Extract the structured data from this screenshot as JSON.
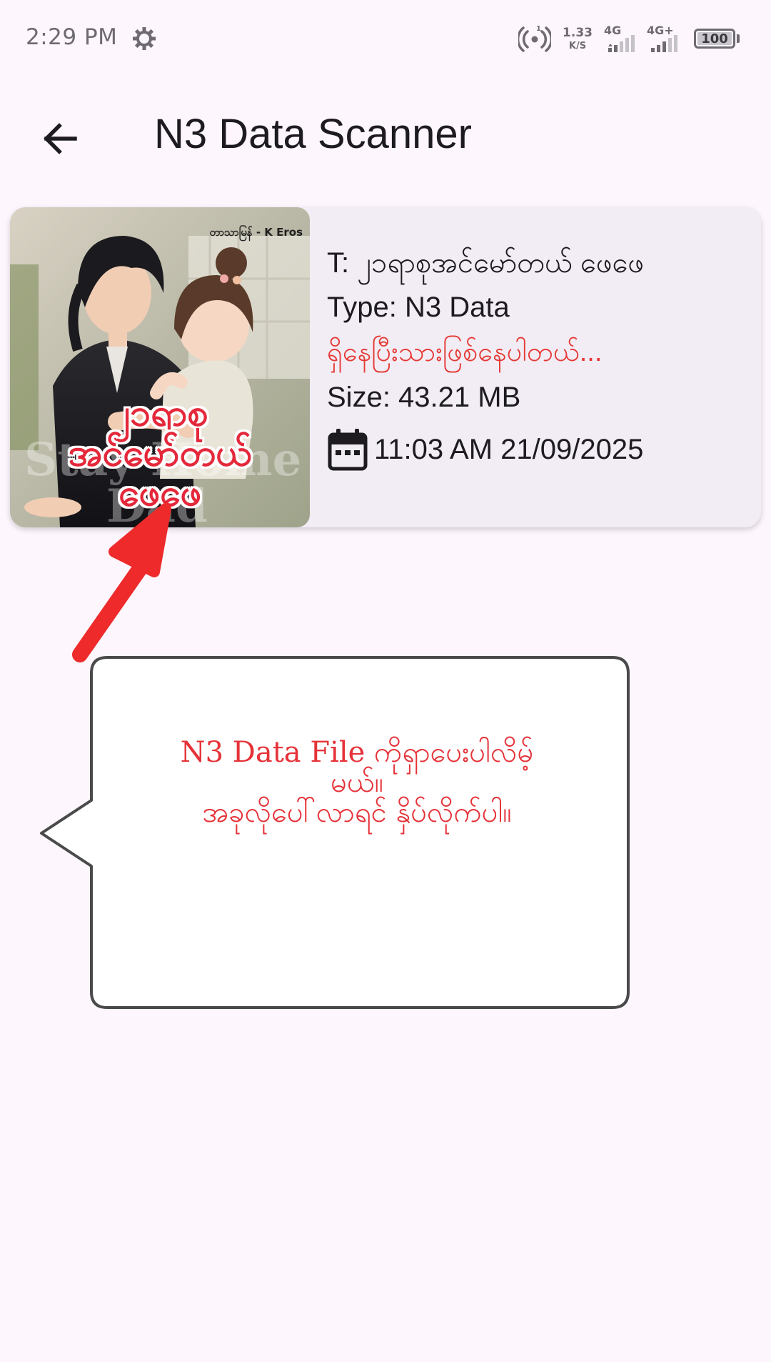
{
  "status_bar": {
    "time": "2:29 PM",
    "net_speed_value": "1.33",
    "net_speed_unit": "K/S",
    "sim1_label": "4G",
    "sim2_label": "4G+",
    "battery": "100",
    "icons": [
      "settings-gear-icon",
      "hotspot-icon",
      "signal-icon",
      "battery-icon"
    ]
  },
  "app_bar": {
    "title": "N3 Data Scanner",
    "back_icon": "arrow-back-icon"
  },
  "card": {
    "cover": {
      "author": "တာသာမြန် - K Eros",
      "title_lines": [
        "၂၁ရာစု",
        "အင်မော်တယ်",
        "ဖေဖေ"
      ]
    },
    "title": "T: ၂၁ရာစုအင်မော်တယ် ဖေဖေ",
    "type": "Type: N3 Data",
    "status": "ရှိနေပြီးသားဖြစ်နေပါတယ်...",
    "size": "Size: 43.21 MB",
    "date": "11:03 AM 21/09/2025",
    "date_icon": "calendar-icon"
  },
  "callout": {
    "line1": "N3 Data File ကိုရှာပေးပါလိမ့်",
    "line2": "မယ်။",
    "line3": "အခုလိုပေါ်လာရင် နှိပ်လိုက်ပါ။"
  },
  "colors": {
    "background": "#fdf6fd",
    "card": "#f2edf4",
    "accent_red": "#e53935",
    "text": "#1d1b20"
  }
}
